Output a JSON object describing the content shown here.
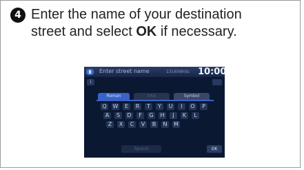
{
  "step": {
    "number": "4",
    "text_before": "Enter the name of your destination",
    "text_line2_before": "street and select ",
    "text_bold": "OK",
    "text_after": " if necessary."
  },
  "screen": {
    "header": {
      "title": "Enter street name",
      "hits": "131656hits",
      "time": "10:00"
    },
    "info_label": "i",
    "tabs": [
      {
        "label": "Roman",
        "active": true
      },
      {
        "label": "AAA",
        "active": false
      },
      {
        "label": "Symbol",
        "active": false
      }
    ],
    "keyboard": {
      "rows": [
        [
          "Q",
          "W",
          "E",
          "R",
          "T",
          "Y",
          "U",
          "I",
          "O",
          "P"
        ],
        [
          "A",
          "S",
          "D",
          "F",
          "G",
          "H",
          "J",
          "K",
          "L"
        ],
        [
          "Z",
          "X",
          "C",
          "V",
          "B",
          "N",
          "M"
        ]
      ],
      "space_label": "Space",
      "ok_label": "OK"
    },
    "colors": {
      "background": "#0b1832",
      "accent": "#3a63c9",
      "key": "#233455"
    }
  }
}
